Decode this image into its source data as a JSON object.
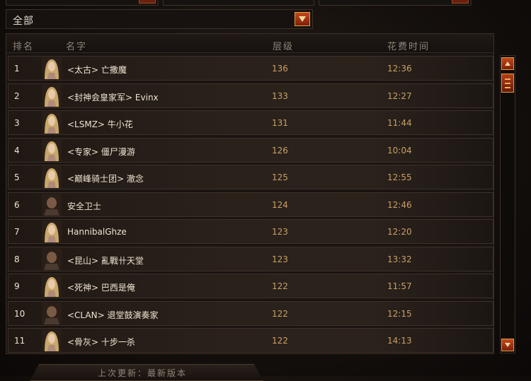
{
  "filter": {
    "selected": "全部"
  },
  "columns": {
    "rank": "排名",
    "name": "名字",
    "tier": "层级",
    "time": "花费时间"
  },
  "rows": [
    {
      "rank": "1",
      "name": "<太古> 亡撒魔",
      "tier": "136",
      "time": "12:36",
      "portrait": "female"
    },
    {
      "rank": "2",
      "name": "<封神会皇家军> Evinx",
      "tier": "133",
      "time": "12:27",
      "portrait": "female"
    },
    {
      "rank": "3",
      "name": "<LSMZ> 牛小花",
      "tier": "131",
      "time": "11:44",
      "portrait": "female"
    },
    {
      "rank": "4",
      "name": "<专家> 僵尸漫游",
      "tier": "126",
      "time": "10:04",
      "portrait": "female"
    },
    {
      "rank": "5",
      "name": "<巅峰骑士团> 澈念",
      "tier": "125",
      "time": "12:55",
      "portrait": "female"
    },
    {
      "rank": "6",
      "name": "安全卫士",
      "tier": "124",
      "time": "12:46",
      "portrait": "male"
    },
    {
      "rank": "7",
      "name": "HannibalGhze",
      "tier": "123",
      "time": "12:20",
      "portrait": "female"
    },
    {
      "rank": "8",
      "name": "<昆山> 亂戰卄天堂",
      "tier": "123",
      "time": "13:32",
      "portrait": "male"
    },
    {
      "rank": "9",
      "name": "<死神> 巴西是俺",
      "tier": "122",
      "time": "11:57",
      "portrait": "female"
    },
    {
      "rank": "10",
      "name": "<CLAN> 退堂鼓演奏家",
      "tier": "122",
      "time": "12:15",
      "portrait": "male"
    },
    {
      "rank": "11",
      "name": "<骨灰> 十步一杀",
      "tier": "122",
      "time": "14:13",
      "portrait": "female"
    }
  ],
  "footer": {
    "text": "上次更新：最新版本"
  },
  "colors": {
    "accent": "#c4481b",
    "accent_border": "#e0a040",
    "value_text": "#c9a066",
    "header_text": "#8f8478"
  },
  "icons": {
    "dropdown": "chevron-down-icon",
    "scroll_up": "arrow-up-icon",
    "scroll_down": "arrow-down-icon",
    "portrait_female": "female-portrait-icon",
    "portrait_male": "male-portrait-icon"
  }
}
